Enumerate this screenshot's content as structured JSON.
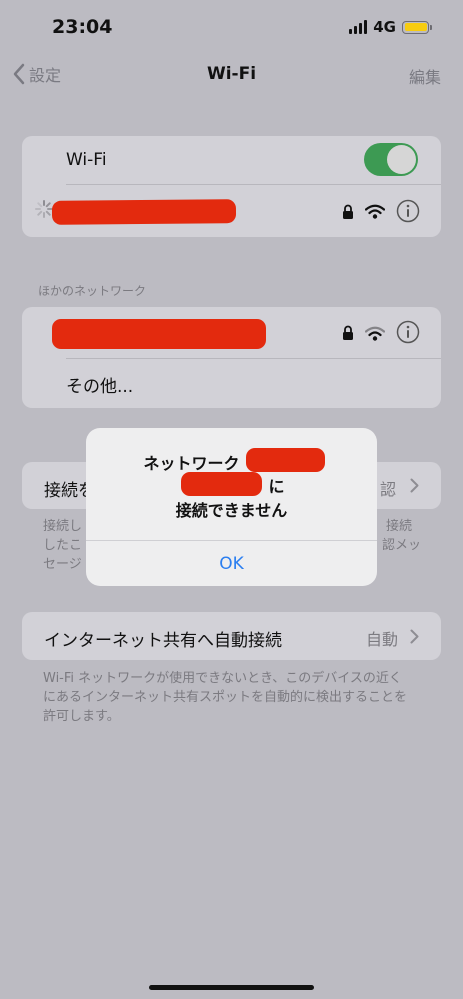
{
  "status_bar": {
    "time": "23:04",
    "network": "4G"
  },
  "nav": {
    "back_label": "設定",
    "title": "Wi-Fi",
    "edit_label": "編集"
  },
  "wifi_card": {
    "wifi_label": "Wi-Fi",
    "wifi_on": true
  },
  "other_networks": {
    "header": "ほかのネットワーク",
    "other_label": "その他..."
  },
  "ask_join": {
    "label_prefix": "接続を",
    "value_suffix": "認",
    "footer_line1_left": "接続し",
    "footer_line1_right": "接続",
    "footer_line2_left": "したこ",
    "footer_line2_right": "認メッ",
    "footer_line3_left": "セージ"
  },
  "hotspot": {
    "label": "インターネット共有へ自動接続",
    "value": "自動",
    "footer_line1": "Wi-Fi ネットワークが使用できないとき、このデバイスの近く",
    "footer_line2": "にあるインターネット共有スポットを自動的に検出することを",
    "footer_line3": "許可します。"
  },
  "alert": {
    "line1": "ネットワーク",
    "line2": "に",
    "line3": "接続できません",
    "ok": "OK"
  },
  "colors": {
    "toggle_on": "#3d9a53",
    "accent": "#2a7ef0",
    "redaction": "#e32a0e",
    "battery": "#f7cc10"
  }
}
